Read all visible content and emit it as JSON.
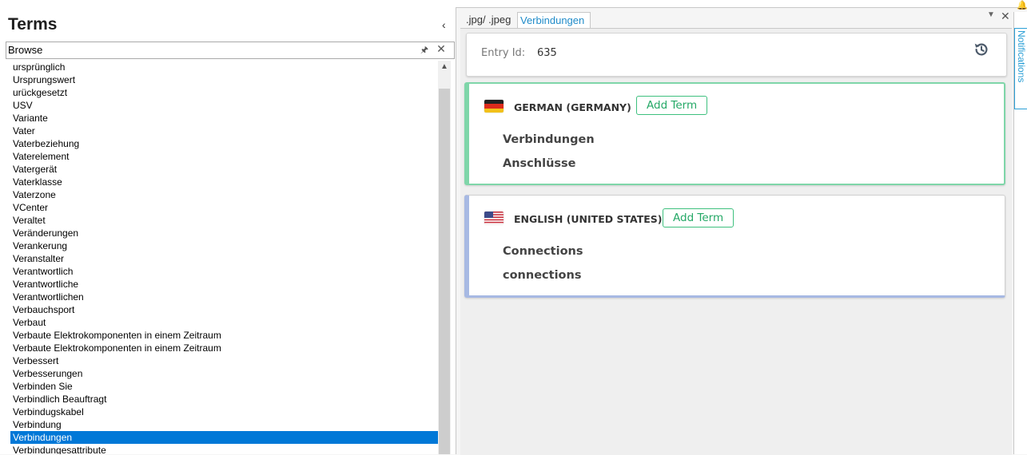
{
  "left_panel": {
    "title": "Terms",
    "browse_value": "Browse",
    "terms": [
      "ursprünglich",
      "Ursprungswert",
      "urückgesetzt",
      "USV",
      "Variante",
      "Vater",
      "Vaterbeziehung",
      "Vaterelement",
      "Vatergerät",
      "Vaterklasse",
      "Vaterzone",
      "VCenter",
      "Veraltet",
      "Veränderungen",
      "Verankerung",
      "Veranstalter",
      "Verantwortlich",
      "Verantwortliche",
      "Verantwortlichen",
      "Verbauchsport",
      "Verbaut",
      "Verbaute Elektrokomponenten in einem Zeitraum",
      "Verbaute Elektrokomponenten in einem Zeitraum",
      "Verbessert",
      "Verbesserungen",
      "Verbinden Sie",
      "Verbindlich Beauftragt",
      "Verbindugskabel",
      "Verbindung",
      "Verbindungen",
      "Verbindungesattribute"
    ],
    "selected_index": 29
  },
  "tabs": [
    {
      "label": ".jpg/ .jpeg",
      "active": false
    },
    {
      "label": "Verbindungen",
      "active": true
    }
  ],
  "notifications_label": "Notifications",
  "entry": {
    "label": "Entry Id:",
    "value": "635"
  },
  "languages": [
    {
      "name": "GERMAN (GERMANY)",
      "add_label": "Add Term",
      "terms": [
        "Verbindungen",
        "Anschlüsse"
      ],
      "accent": "#7fd6a9"
    },
    {
      "name": "ENGLISH (UNITED STATES)",
      "add_label": "Add Term",
      "terms": [
        "Connections",
        "connections"
      ],
      "accent": "#a7b9e3"
    }
  ],
  "colors": {
    "selection": "#0078d7",
    "tab_active": "#1f8bc9",
    "add_button": "#24a866"
  }
}
